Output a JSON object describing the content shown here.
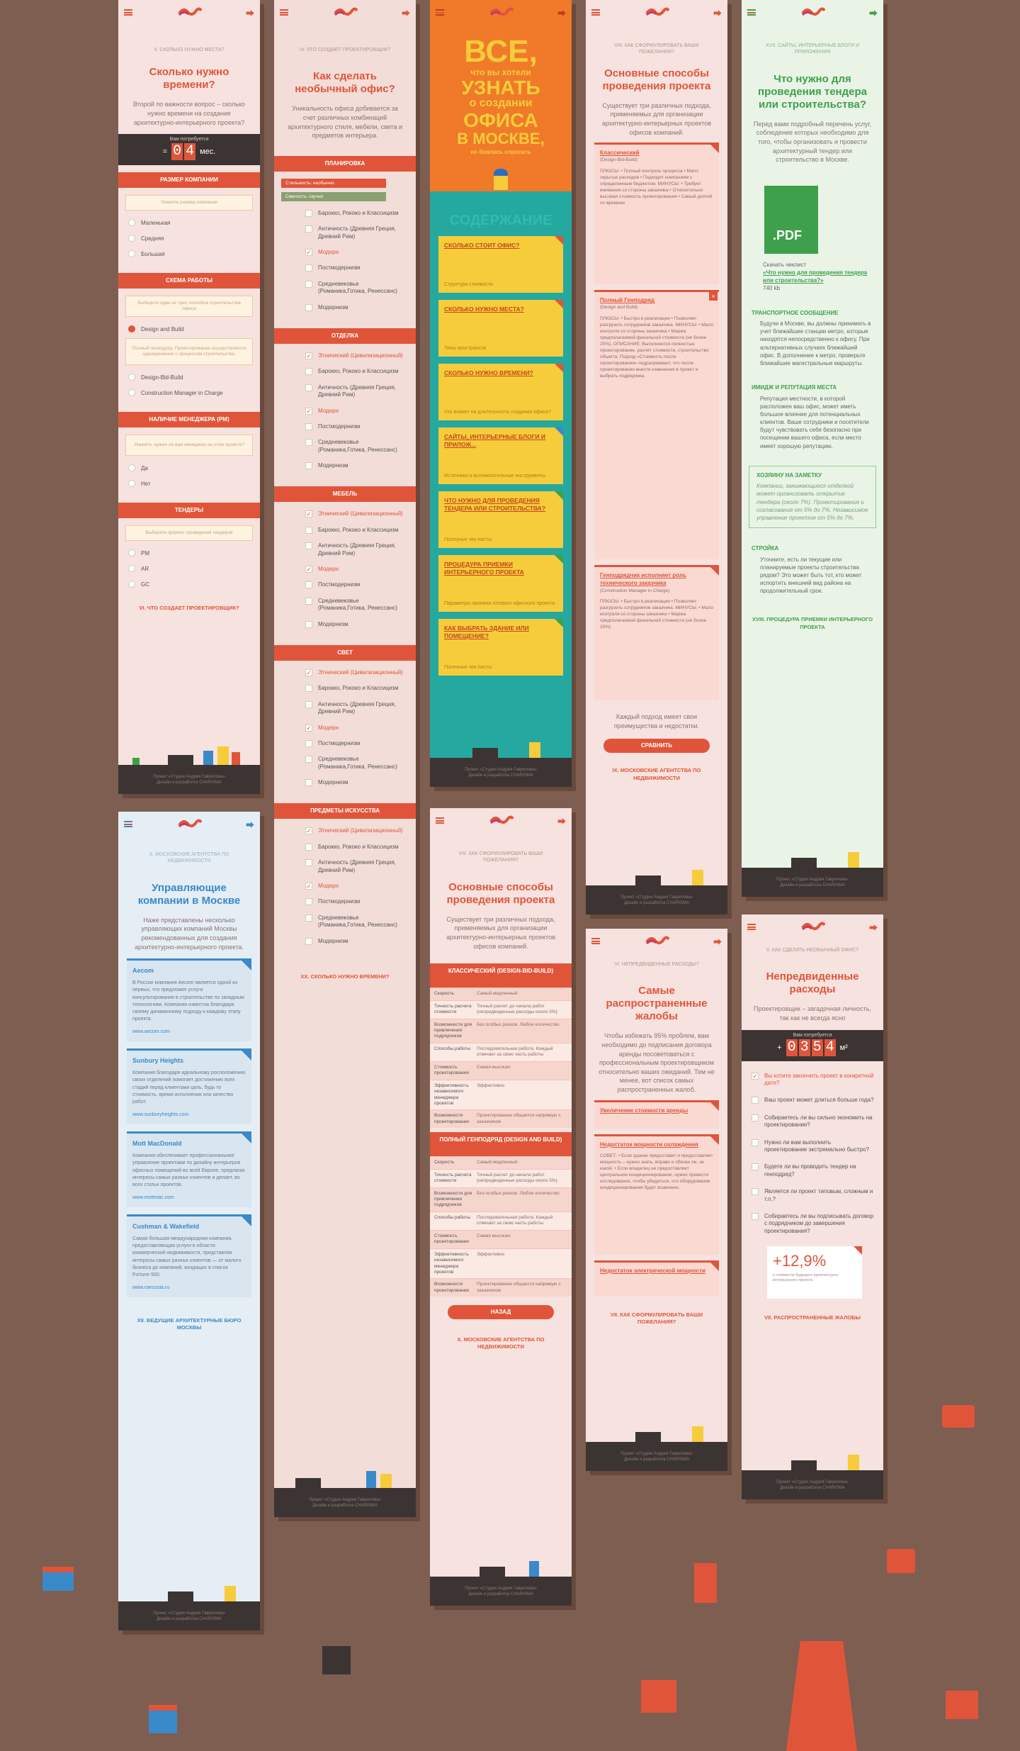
{
  "colors": {
    "bg": "#7e5e51",
    "accent": "#e0553a",
    "green": "#3ea04a",
    "blue": "#3a89c9",
    "yellow": "#f6cc3a",
    "orange": "#f07a2a"
  },
  "footer": {
    "line1": "Проект «Студии Андрея Гаврилова»",
    "line2": "Дизайн и разработка CHARISMA"
  },
  "p1": {
    "kicker": "V. Сколько нужно места?",
    "title": "Сколько нужно времени?",
    "lead": "Второй по важности вопрос – сколько нужно времени на создание архитектурно-интерьерного проекта?",
    "counter_cap": "Вам потребуется",
    "d1": "0",
    "d2": "4",
    "unit": "мес.",
    "sec1": "Размер компании",
    "f1": "Укажите размер компании",
    "r1": [
      "Маленькая",
      "Средняя",
      "Большая"
    ],
    "sec2": "Схема работы",
    "f2": "Выберите один из трех способов строительства офиса",
    "r2": [
      "Design and Build",
      "Design-Bid-Build",
      "Construction Manager in Charge"
    ],
    "note2": "Полный генподряд. Проектирование осуществляется одновременно с процессом строительства.",
    "sec3": "Наличие менеджера (PM)",
    "f3": "Укажите, нужен ли вам менеджер на этом проекте?",
    "r3": [
      "Да",
      "Нет"
    ],
    "sec4": "Тендеры",
    "f4": "Выберите формат проведения тендеров",
    "r4": [
      "PM",
      "AR",
      "GC"
    ],
    "next": "VI. Что создает проектировщик?"
  },
  "p2": {
    "kicker": "IV. Что создает проектировщик?",
    "title": "Как сделать необычный офис?",
    "lead": "Уникальность офиса добивается за счет различных комбинаций архитектурного стиля, мебели, света и предметов интерьера.",
    "sec1": "Планировка",
    "bar1": "Стильность: необычно",
    "bar2": "Смелость: скучно",
    "opts": [
      "Барокко, Рококо и Классицизм",
      "Античность (Древняя Греция, Древний Рим)",
      "Модерн",
      "Постмодернизм",
      "Средневековье (Романика,Готика, Ренессанс)",
      "Модернизм"
    ],
    "opt0": "Этнический (Цивилизационный)",
    "sec2": "Отделка",
    "sec3": "Мебель",
    "sec4": "Свет",
    "sec5": "Предметы искусства",
    "next": "XX. Сколько нужно времени?"
  },
  "p3": {
    "hero1": "ВСЕ,",
    "hero2": "что вы хотели",
    "hero3": "УЗНАТЬ",
    "hero4": "о создании",
    "hero5": "ОФИСА",
    "hero6": "В МОСКВЕ,",
    "hero7": "но боялись спросить",
    "toc": "СОДЕРЖАНИЕ",
    "items": [
      {
        "t": "Сколько стоит офис?",
        "s": "Структура стоимости"
      },
      {
        "t": "Сколько нужно места?",
        "s": "Типы пространств"
      },
      {
        "t": "Сколько нужно времени?",
        "s": "Что влияет на длительность создания офиса?"
      },
      {
        "t": "Сайты, интерьерные блоги и прилож...",
        "s": "Источники и вспомогательные инструменты"
      },
      {
        "t": "Что нужно для проведения тендера или строительства?",
        "s": "Полезные чек-листы"
      },
      {
        "t": "Процедура приемки интерьерного проекта",
        "s": "Параметры приемки готового офисного проекта"
      },
      {
        "t": "Как выбрать здание или помещение?",
        "s": "Полезные чек-листы"
      }
    ]
  },
  "p4": {
    "kicker": "VIII. Как сформулировать ваши пожелания?",
    "title": "Основные способы проведения проекта",
    "lead": "Существует три различных подхода, применяемых для организации архитектурно-интерьерных проектов офисов компаний.",
    "c1t": "Классический",
    "c1s": "(Design-Bid-Build)",
    "c1b": "ПЛЮСЫ: • Полный контроль процесса • Мало скрытых расходов • Подходит компаниям с определенным бюджетом. МИНУСЫ: • Требует внимания со стороны заказчика • Относительно высокая стоимость проектирования • Самый долгий по времени",
    "c2t": "Полный Генподряд",
    "c2s": "(Design and Build)",
    "c2b": "ПЛЮСЫ: • Быстро в реализации • Позволяет разгрузить сотрудников заказчика. МИНУСЫ: • Мало контроля со стороны заказчика • Маржа предполагаемой финальной стоимости (не более 20%). ОПИСАНИЕ: Выполняется полностью проектирование, расчёт стоимости, строительство объекта. Подход «Стоимость после проектирования» подразумевает, что после проектирования внести изменения в проект и выбрать подрядчика.",
    "c3t": "Генподрядчик исполняет роль технического заказчика",
    "c3s": "(Construction Manager in Charge)",
    "c3b": "ПЛЮСЫ: • Быстро в реализации • Позволяет разгрузить сотрудников заказчика. МИНУСЫ: • Мало контроля со стороны заказчика • Маржа предполагаемой финальной стоимости (не более 20%)",
    "outro": "Каждый подход имеет свои преимущества и недостатки.",
    "btn": "Сравнить",
    "next": "IX. Московские агентства по недвижимости"
  },
  "p5": {
    "kicker": "XVII. Сайты, интерьерные блоги и приложения",
    "title": "Что нужно для проведения тендера или строительства?",
    "lead": "Перед вами подробный перечень услуг, соблюдение которых необходимо для того, чтобы организовать и провести архитектурный тендер или строительство в Москве.",
    "pdf": ".PDF",
    "dl": "Скачать чеклист",
    "dll": "«Что нужно для проведения тендера или строительства?»",
    "size": "740 kb",
    "h1": "Транспортное сообщение",
    "p1": "Будучи в Москве, вы должны принимать в учет ближайшие станции метро, которые находятся непосредственно к офису. При альтернативных случаях ближайший офис. В дополнение к метро, проверьте ближайшие магистральные маршруты.",
    "h2": "Имидж и репутация места",
    "p2": "Репутация местности, в которой расположен ваш офис, может иметь большое влияние для потенциальных клиентов. Ваше сотрудники и посетители будут чувствовать себя безопасно при посещении вашего офиса, если место имеет хорошую репутацию.",
    "note_h": "Хозяину на заметку",
    "note": "Компании, занимающиеся отделкой может организовать открытие тендера (около 7%). Проектирование и согласование от 5% до 7%. Независимое управление проектом от 5% до 7%.",
    "h3": "Стройка",
    "p3": "Уточните, есть ли текущие или планируемые проекты строительства рядом? Это может быть тот, кто может испортить внешний вид района на продолжительный срок.",
    "next": "XVIII. Процедура приемки интерьерного проекта"
  },
  "p6": {
    "kicker": "X. Московские агентства по недвижимости",
    "title": "Управляющие компании в Москве",
    "lead": "Наже представлены несколько управляющих компаний Москвы рекомендованных для создания архитектурно-интерьерного проекта.",
    "cards": [
      {
        "t": "Aecom",
        "b": "В России компания Aecom является одной из первых, что предложил услуги консультирования в строительстве по западным технологиям. Компания известна благодаря своему динамичному подходу к каждому этапу проекта.",
        "u": "www.aecom.com"
      },
      {
        "t": "Sunbury Heights",
        "b": "Компания благодаря идеальному росположению своих отделений помогает достижению всех стадий перед клиентами цель, будь то стоимость, время исполнения или качество работ.",
        "u": "www.sunburyheights.com"
      },
      {
        "t": "Mott MacDonald",
        "b": "Компания обеспечивает профессиональное управление проектами по дизайну интерьеров офисных помещений во всей Европе, предлагая интересы самых разных клиентов и делает, во всех статьи проектов.",
        "u": "www.mottmac.com"
      },
      {
        "t": "Cushman & Wakefield",
        "b": "Самая большая международная компания, предоставляющая услуги в области коммерческой недвижимости, представляя интересы самых разных клиентов — от малого бизнеса до компаний, входящих в список Fortune 500.",
        "u": "www.cwrussia.ru"
      }
    ],
    "next": "XII. Ведущие архитектурные бюро Москвы"
  },
  "p7": {
    "kicker": "VIII. Как сформулировать ваши пожелания?",
    "title": "Основные способы проведения проекта",
    "lead": "Существует три различных подхода, применяемых для организации архитектурно-интерьерных проектов офисов компаний.",
    "h1": "Классический (Design-Bid-Build)",
    "h2": "Полный генподряд (Design and Build)",
    "rows": [
      {
        "a": "Скорость",
        "b": "Самый медленный"
      },
      {
        "a": "Точность расчета стоимости",
        "b": "Точный расчет до начала работ (непредвиденные расходы около 5%)"
      },
      {
        "a": "Возможности для привлечения подрядчиков",
        "b": "Без особых рисков. Любое количество"
      },
      {
        "a": "Способы работы",
        "b": "Последовательная работа. Каждый отвечает за свою часть работы"
      },
      {
        "a": "Стоимость проектирования",
        "b": "Самая высокая"
      },
      {
        "a": "Эффективность независимого менеджера проектов",
        "b": "Эффективно"
      },
      {
        "a": "Возможности проектирования",
        "b": "Проектирование общается напрямую с заказчиком"
      }
    ],
    "btn": "Назад",
    "next": "X. Московские агентства по недвижимости"
  },
  "p8": {
    "kicker": "VI. Непредвиденные расходы?",
    "title": "Самые распространенные жалобы",
    "lead": "Чтобы избежать 95% проблем, вам необходимо до подписания договора аренды посоветоваться с профессиональным проектировщиком относительно ваших ожиданий. Тем не менее, вот список самых распространенных жалоб.",
    "c1": "Увеличение стоимости аренды",
    "c2": "Недостаток мощности охлаждения",
    "c2b": "СОВЕТ: • Если здание предоставит и предоставляет мощность – нужно знать, вправе и обязан ли, за какой. • Если владелец не предоставляет центральное кондиционирование, нужно провести исследование, чтобы убедиться, что оборудование кондиционирования будет возможно.",
    "c3": "Недостаток электрической мощности",
    "next": "VII. Как сформулировать ваши пожелания?"
  },
  "p9": {
    "kicker": "V. Как сделать необычный офис?",
    "title": "Непредвиденные расходы",
    "lead": "Проектировщик – загадочная личность, так как не всегда ясно",
    "counter_cap": "Вам потребуется",
    "sign": "+",
    "digits": [
      "0",
      "3",
      "5",
      "4"
    ],
    "unit": "м²",
    "q": [
      "Вы хотите закончить проект в конкретной дате?",
      "Ваш проект может длиться больше года?",
      "Собираетесь ли вы сильно экономить на проектировании?",
      "Нужно ли вам выполнить проектирование экстремально быстро?",
      "Будете ли вы проводить тендер на генподряд?",
      "Является ли проект типовым, сложным и т.п.?",
      "Собираетесь ли вы подписывать договор с подрядчиком до завершения проектирования?"
    ],
    "pct": "+12,9%",
    "pct_note": "к стоимости будущего архитектурно-интерьерного проекта",
    "next": "VII. Распространенные жалобы"
  }
}
